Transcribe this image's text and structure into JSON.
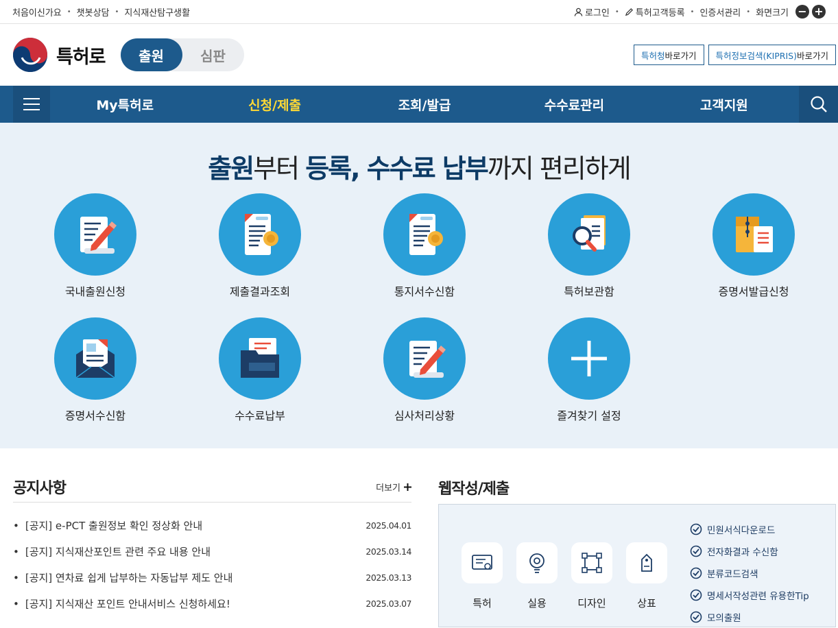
{
  "topbar": {
    "links": [
      "처음이신가요",
      "챗봇상담",
      "지식재산탐구생활"
    ],
    "login": "로그인",
    "register": "특허고객등록",
    "cert": "인증서관리",
    "zoom_label": "화면크기"
  },
  "header": {
    "logo_text": "특허로",
    "toggle": [
      "출원",
      "심판"
    ],
    "ext1_blue": "특허청",
    "ext1_rest": " 바로가기",
    "ext2_blue": "특허정보검색(KIPRIS)",
    "ext2_rest": " 바로가기"
  },
  "nav": {
    "items": [
      "My특허로",
      "신청/제출",
      "조회/발급",
      "수수료관리",
      "고객지원"
    ],
    "active_index": 1
  },
  "hero": {
    "title_parts": [
      "출원",
      "부터 ",
      "등록, 수수료 납부",
      "까지 편리하게"
    ],
    "services": [
      "국내출원신청",
      "제출결과조회",
      "통지서수신함",
      "특허보관함",
      "증명서발급신청",
      "증명서수신함",
      "수수료납부",
      "심사처리상황",
      "즐겨찾기 설정"
    ]
  },
  "notice": {
    "title": "공지사항",
    "more": "더보기",
    "items": [
      {
        "title": "[공지] e-PCT 출원정보 확인 정상화 안내",
        "date": "2025.04.01"
      },
      {
        "title": "[공지] 지식재산포인트 관련 주요 내용 안내",
        "date": "2025.03.14"
      },
      {
        "title": "[공지] 연차료 쉽게 납부하는 자동납부 제도 안내",
        "date": "2025.03.13"
      },
      {
        "title": "[공지] 지식재산 포인트 안내서비스 신청하세요!",
        "date": "2025.03.07"
      }
    ]
  },
  "web": {
    "title": "웹작성/제출",
    "types": [
      "특허",
      "실용",
      "디자인",
      "상표"
    ],
    "quick": [
      "민원서식다운로드",
      "전자화결과 수신함",
      "분류코드검색",
      "명세서작성관련 유용한Tip",
      "모의출원"
    ]
  },
  "colors": {
    "primary": "#1d5a8c",
    "accent_yellow": "#ffd935",
    "circle_blue": "#2a9fd8",
    "hero_bg": "#e9f1f8"
  }
}
